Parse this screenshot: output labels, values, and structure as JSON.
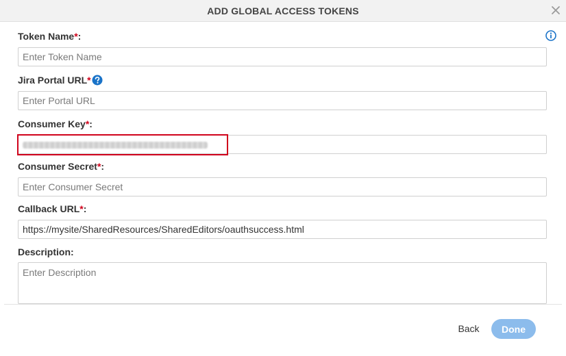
{
  "dialog": {
    "title": "ADD GLOBAL ACCESS TOKENS",
    "close_icon": "close-icon",
    "info_icon": "info-icon"
  },
  "fields": {
    "token_name": {
      "label": "Token Name",
      "required_mark": "*",
      "colon": ":",
      "placeholder": "Enter Token Name",
      "value": ""
    },
    "jira_portal_url": {
      "label": "Jira Portal URL",
      "required_mark": "*",
      "help_icon": "help-icon",
      "placeholder": "Enter Portal URL",
      "value": ""
    },
    "consumer_key": {
      "label": "Consumer Key",
      "required_mark": "*",
      "colon": ":",
      "value_obscured": true
    },
    "consumer_secret": {
      "label": "Consumer Secret",
      "required_mark": "*",
      "colon": ":",
      "placeholder": "Enter Consumer Secret",
      "value": ""
    },
    "callback_url": {
      "label": "Callback URL",
      "required_mark": "*",
      "colon": ":",
      "value": "https://mysite/SharedResources/SharedEditors/oauthsuccess.html"
    },
    "description": {
      "label": "Description:",
      "placeholder": "Enter Description",
      "value": ""
    }
  },
  "footer": {
    "back_label": "Back",
    "done_label": "Done"
  },
  "colors": {
    "required": "#d0021b",
    "accent": "#1a73c8",
    "done_button": "#8cbcec",
    "highlight_box": "#d0021b"
  }
}
